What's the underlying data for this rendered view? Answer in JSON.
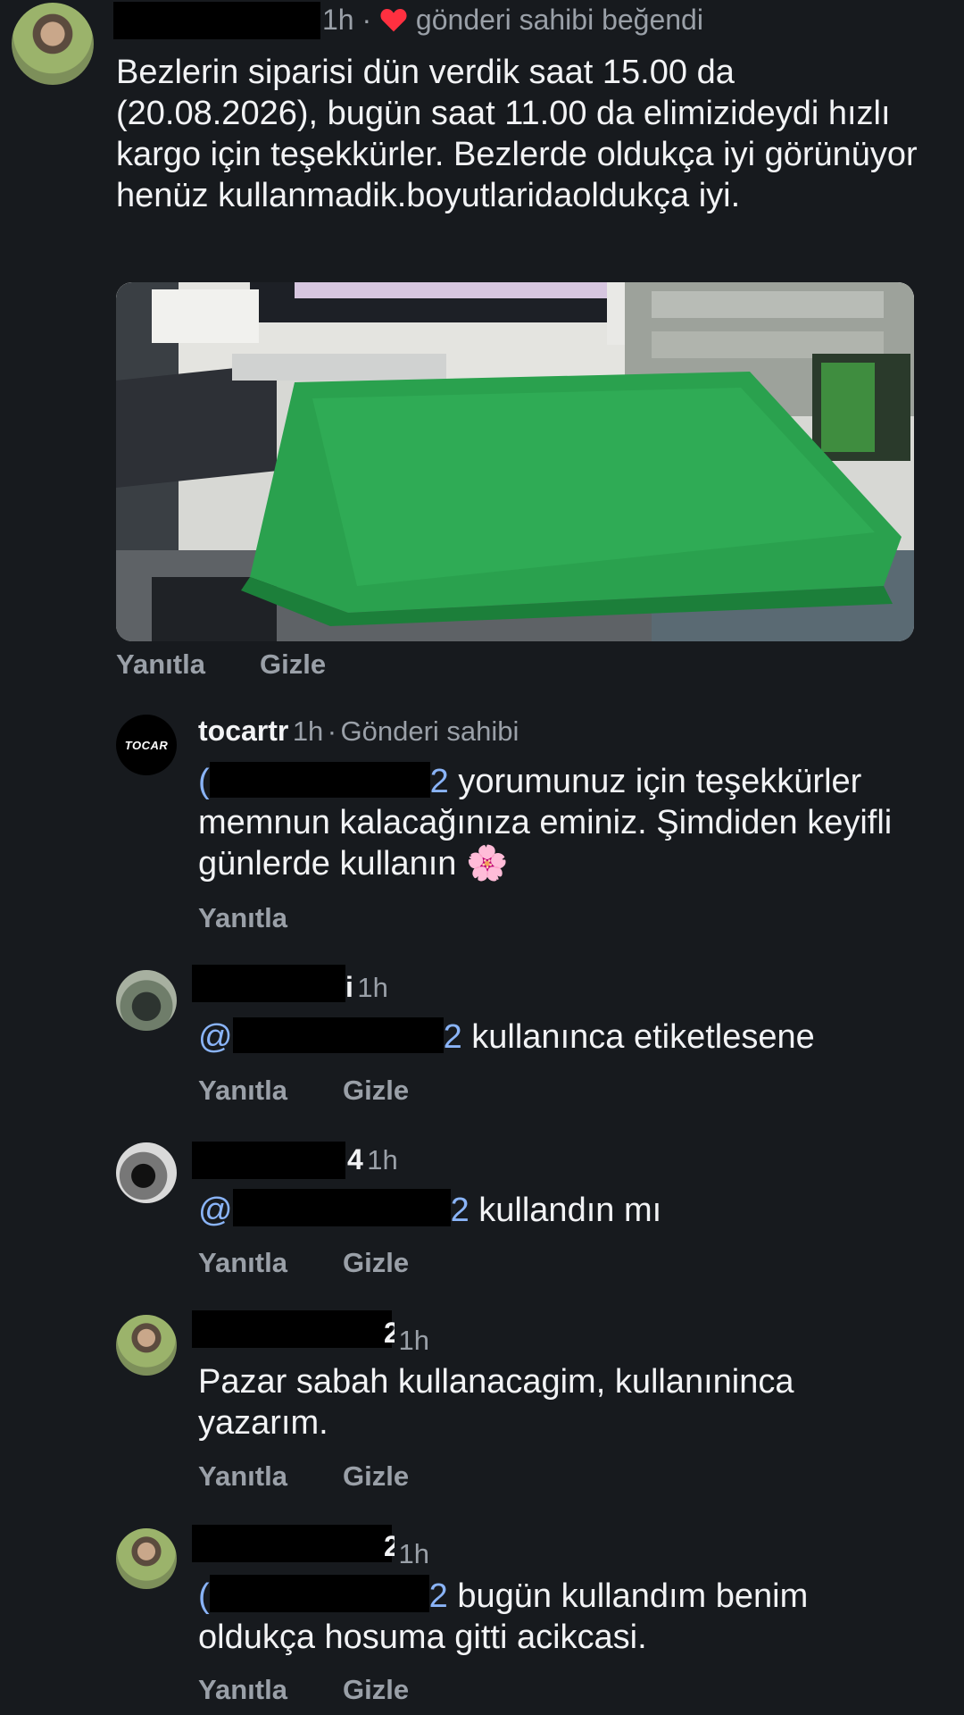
{
  "colors": {
    "background": "#171a1e",
    "text": "#f2f3f5",
    "muted": "#9aa0a8",
    "mention": "#8ab4f8",
    "heart": "#ff3040"
  },
  "comment1": {
    "time": "1h",
    "sep": "·",
    "liked_text": "gönderi sahibi beğendi",
    "body": "Bezlerin siparisi dün verdik saat 15.00 da (20.08.2026), bugün saat 11.00 da elimizideydi hızlı kargo için teşekkürler. Bezlerde  oldukça iyi görünüyor henüz kullanmadik.boyutlaridaoldukça iyi.",
    "reply": "Yanıtla",
    "hide": "Gizle"
  },
  "reply1": {
    "username": "tocartr",
    "time": "1h",
    "sep": "·",
    "role": "Gönderi sahibi",
    "logo_text": "TOCAR",
    "mention_start": "(",
    "mention_end": "2",
    "body": " yorumunuz için teşekkürler memnun kalacağınıza eminiz. Şimdiden keyifli günlerde kullanın",
    "emoji": "🌸",
    "reply": "Yanıtla"
  },
  "reply2": {
    "name_tail": "i",
    "time": "1h",
    "mention_start": "@",
    "mention_end": "2",
    "body": " kullanınca etiketlesene",
    "reply": "Yanıtla",
    "hide": "Gizle"
  },
  "reply3": {
    "name_tail": "4",
    "time": "1h",
    "mention_start": "@",
    "mention_end": "2",
    "body": " kullandın mı",
    "reply": "Yanıtla",
    "hide": "Gizle"
  },
  "reply4": {
    "name_tail": "2",
    "time": "1h",
    "body": "Pazar sabah kullanacagim, kullanıninca yazarım.",
    "reply": "Yanıtla",
    "hide": "Gizle"
  },
  "reply5": {
    "name_tail": "2",
    "time": "1h",
    "mention_start": "(",
    "mention_end": "2",
    "body": " bugün kullandım benim oldukça hosuma gitti acikcasi.",
    "reply": "Yanıtla",
    "hide": "Gizle"
  }
}
